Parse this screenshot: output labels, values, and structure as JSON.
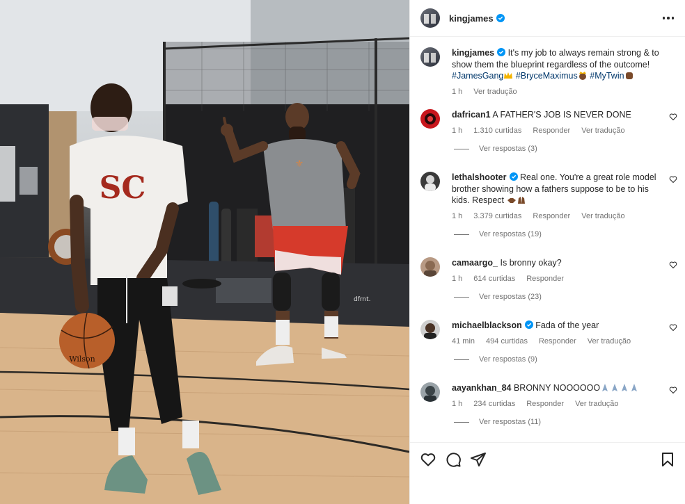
{
  "header": {
    "username": "kingjames",
    "more_icon": "more-horizontal-icon"
  },
  "caption": {
    "username": "kingjames",
    "text": "It's my job to always remain strong & to show them the blueprint regardless of the outcome!",
    "hashtags": [
      "#JamesGang",
      "#BryceMaximus",
      "#MyTwin"
    ],
    "time": "1 h",
    "translate": "Ver tradução"
  },
  "comments": [
    {
      "username": "dafrican1",
      "verified": false,
      "text": "A FATHER'S JOB IS NEVER DONE",
      "time": "1 h",
      "likes": "1.310 curtidas",
      "reply": "Responder",
      "translate": "Ver tradução",
      "replies": "Ver respostas (3)"
    },
    {
      "username": "lethalshooter",
      "verified": true,
      "text": "Real one. You're a great role model brother showing how a fathers suppose to be to his kids. Respect",
      "time": "1 h",
      "likes": "3.379 curtidas",
      "reply": "Responder",
      "translate": "Ver tradução",
      "replies": "Ver respostas (19)"
    },
    {
      "username": "camaargo_",
      "verified": false,
      "text": "Is bronny okay?",
      "time": "1 h",
      "likes": "614 curtidas",
      "reply": "Responder",
      "replies": "Ver respostas (23)"
    },
    {
      "username": "michaelblackson",
      "verified": true,
      "text": "Fada of the year",
      "time": "41 min",
      "likes": "494 curtidas",
      "reply": "Responder",
      "translate": "Ver tradução",
      "replies": "Ver respostas (9)"
    },
    {
      "username": "aayankhan_84",
      "verified": false,
      "text": "BRONNY NOOOOOO",
      "time": "1 h",
      "likes": "234 curtidas",
      "reply": "Responder",
      "translate": "Ver tradução",
      "replies": "Ver respostas (11)"
    }
  ],
  "photo": {
    "shirt_lettering": "SC",
    "ball_lettering": "Wilson",
    "mat_lettering": "dfrnt."
  },
  "colors": {
    "verified": "#0095f6",
    "hashtag": "#00376b",
    "secondary_text": "#737373",
    "primary_text": "#262626"
  }
}
